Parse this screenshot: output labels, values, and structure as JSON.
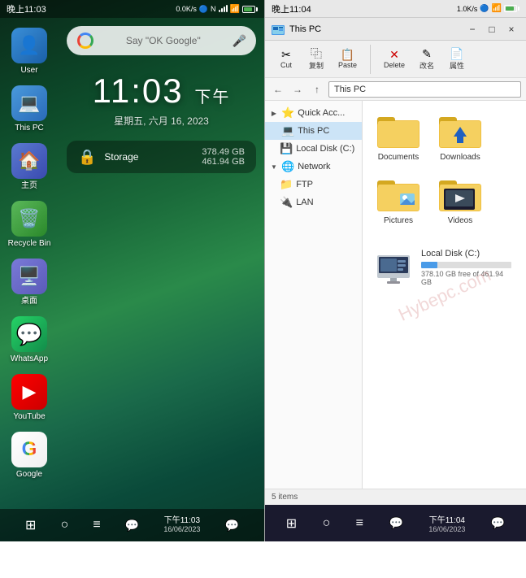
{
  "left_panel": {
    "status_bar": {
      "time": "晚上11:03",
      "speed": "0.0K/s",
      "wifi": "WiFi",
      "signal_bars": 4,
      "battery_pct": 88
    },
    "search_hint": "Say \"OK Google\"",
    "clock": {
      "time": "11:03",
      "period": "下午",
      "date": "星期五, 六月 16, 2023"
    },
    "storage": {
      "label": "Storage",
      "used": "378.49 GB",
      "total": "461.94 GB"
    },
    "icons": [
      {
        "id": "user",
        "label": "User",
        "emoji": "👤",
        "color_class": "icon-user"
      },
      {
        "id": "this-pc",
        "label": "This PC",
        "emoji": "💻",
        "color_class": "icon-pc"
      },
      {
        "id": "home",
        "label": "主页",
        "emoji": "🏠",
        "color_class": "icon-home"
      },
      {
        "id": "recycle-bin",
        "label": "Recycle Bin",
        "emoji": "🗑️",
        "color_class": "icon-recycle"
      },
      {
        "id": "desktop",
        "label": "桌面",
        "emoji": "🖥️",
        "color_class": "icon-desktop"
      },
      {
        "id": "whatsapp",
        "label": "WhatsApp",
        "emoji": "💬",
        "color_class": "icon-whatsapp"
      },
      {
        "id": "youtube",
        "label": "YouTube",
        "emoji": "▶",
        "color_class": "icon-youtube"
      },
      {
        "id": "google",
        "label": "Google",
        "emoji": "G",
        "color_class": "icon-google"
      }
    ],
    "bottom_nav": {
      "time": "下午11:03",
      "date": "16/06/2023",
      "buttons": [
        "⊞",
        "○",
        "≡"
      ]
    }
  },
  "right_panel": {
    "status_bar": {
      "time": "晚上11:04",
      "speed": "1.0K/s",
      "battery_pct": 88
    },
    "titlebar": {
      "title": "This PC",
      "min": "−",
      "max": "□",
      "close": "×"
    },
    "toolbar": {
      "buttons": [
        {
          "id": "cut",
          "icon": "✂",
          "label": "Cut"
        },
        {
          "id": "copy",
          "icon": "⿻",
          "label": "复制"
        },
        {
          "id": "paste",
          "icon": "📋",
          "label": "Paste"
        },
        {
          "id": "delete",
          "icon": "✕",
          "label": "Delete"
        },
        {
          "id": "rename",
          "icon": "✎",
          "label": "改名"
        },
        {
          "id": "properties",
          "icon": "ℹ",
          "label": "属性"
        }
      ]
    },
    "addressbar": {
      "path": "This PC",
      "back_enabled": true,
      "forward_enabled": false
    },
    "sidebar": {
      "items": [
        {
          "id": "quick-access",
          "label": "Quick Acc...",
          "icon": "⭐",
          "arrow": "▶",
          "indent": 0,
          "selected": false
        },
        {
          "id": "this-pc",
          "label": "This PC",
          "icon": "💻",
          "arrow": "",
          "indent": 0,
          "selected": true
        },
        {
          "id": "local-disk-c",
          "label": "Local Disk (C:)",
          "icon": "💾",
          "arrow": "",
          "indent": 1,
          "selected": false
        },
        {
          "id": "network",
          "label": "Network",
          "icon": "🌐",
          "arrow": "▼",
          "indent": 0,
          "selected": false
        },
        {
          "id": "ftp",
          "label": "FTP",
          "icon": "📁",
          "arrow": "",
          "indent": 1,
          "selected": false
        },
        {
          "id": "lan",
          "label": "LAN",
          "icon": "🔌",
          "arrow": "",
          "indent": 1,
          "selected": false
        }
      ]
    },
    "files": {
      "folders": [
        {
          "id": "documents",
          "label": "Documents",
          "type": "folder"
        },
        {
          "id": "downloads",
          "label": "Downloads",
          "type": "folder-download"
        },
        {
          "id": "pictures",
          "label": "Pictures",
          "type": "folder-pictures"
        },
        {
          "id": "videos",
          "label": "Videos",
          "type": "folder-videos"
        }
      ],
      "drives": [
        {
          "id": "local-disk-c",
          "label": "Local Disk (C:)",
          "free": "378.10 GB free of 461.94 GB",
          "used_pct": 18,
          "total": "461.94 GB"
        }
      ]
    },
    "bottom_nav": {
      "time": "下午11:04",
      "date": "16/06/2023"
    },
    "watermark": "Hybepc.com"
  }
}
